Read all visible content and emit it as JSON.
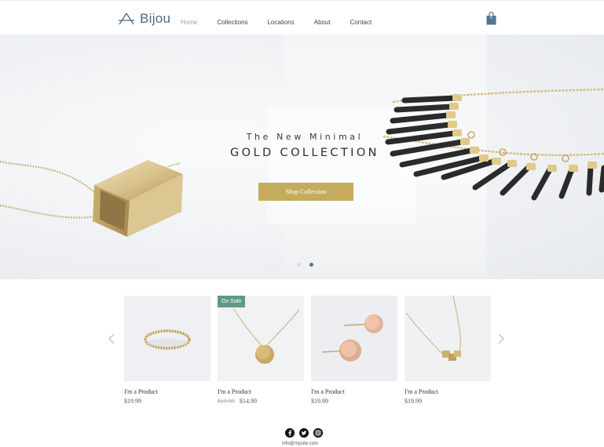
{
  "header": {
    "logo_text": "Bijou",
    "nav": [
      "Home",
      "Collections",
      "Locations",
      "About",
      "Contact"
    ],
    "active_nav": "Home",
    "cart_count": "0"
  },
  "hero": {
    "subtitle": "The New Minimal",
    "title": "GOLD COLLECTION",
    "cta": "Shop Collection",
    "slide_count": 2,
    "active_slide": 2
  },
  "products": [
    {
      "name": "I'm a Product",
      "price": "$19.99",
      "old_price": "",
      "badge": ""
    },
    {
      "name": "I'm a Product",
      "price": "$14.99",
      "old_price": "$19.99",
      "badge": "On Sale"
    },
    {
      "name": "I'm a Product",
      "price": "$19.99",
      "old_price": "",
      "badge": ""
    },
    {
      "name": "I'm a Product",
      "price": "$19.99",
      "old_price": "",
      "badge": ""
    }
  ],
  "footer": {
    "social": [
      "facebook-icon",
      "twitter-icon",
      "instagram-icon"
    ],
    "email": "info@mysite.com"
  },
  "colors": {
    "accent_gold": "#c5ab5d",
    "brand_blue": "#4a6a86",
    "sale_green": "#5e9a8a"
  }
}
